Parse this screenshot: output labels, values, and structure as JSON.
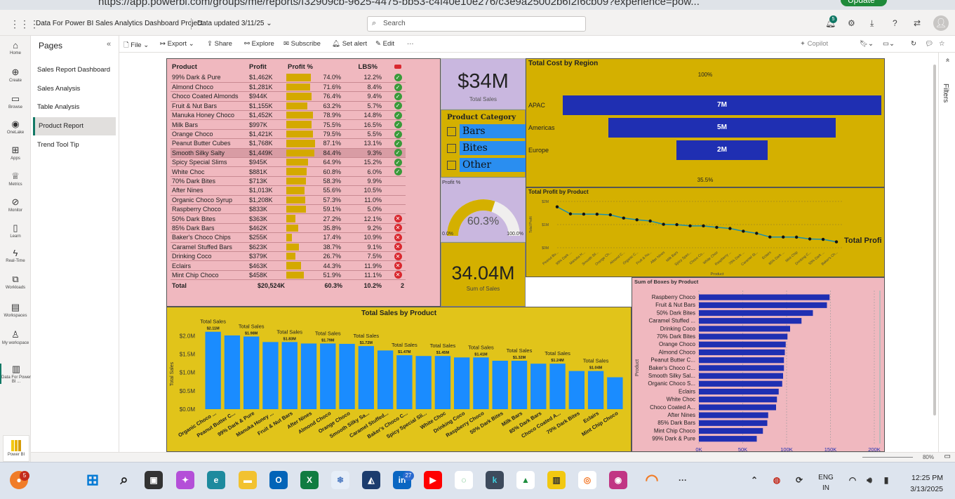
{
  "browser": {
    "url": "https://app.powerbi.com/groups/me/reports/f32909cb-9625-4475-bb53-c4f40e10e276/c3e9a25002b6f2f6cb09?experience=pow...",
    "update_label": "Update"
  },
  "app": {
    "title": "Data For Power BI Sales Analytics Dashboard Project",
    "updated": "Data updated 3/11/25",
    "search_placeholder": "Search",
    "notif_count": "5"
  },
  "nav": [
    {
      "label": "Home",
      "icon": "home-icon",
      "glyph": "⌂"
    },
    {
      "label": "Create",
      "icon": "plus-icon",
      "glyph": "⊕"
    },
    {
      "label": "Browse",
      "icon": "folder-icon",
      "glyph": "▭"
    },
    {
      "label": "OneLake",
      "icon": "onelake-icon",
      "glyph": "◉"
    },
    {
      "label": "Apps",
      "icon": "apps-icon",
      "glyph": "⊞"
    },
    {
      "label": "Metrics",
      "icon": "trophy-icon",
      "glyph": "♕"
    },
    {
      "label": "Monitor",
      "icon": "monitor-icon",
      "glyph": "⊘"
    },
    {
      "label": "Learn",
      "icon": "book-icon",
      "glyph": "▯"
    },
    {
      "label": "Real-Time",
      "icon": "lightning-icon",
      "glyph": "ϟ"
    },
    {
      "label": "Workloads",
      "icon": "workloads-icon",
      "glyph": "⧉"
    },
    {
      "label": "Workspaces",
      "icon": "workspaces-icon",
      "glyph": "▤"
    },
    {
      "label": "My workspace",
      "icon": "person-icon",
      "glyph": "♙"
    },
    {
      "label": "Data For Power BI ...",
      "icon": "report-icon",
      "glyph": "▥"
    }
  ],
  "powerbi_label": "Power BI",
  "pages": {
    "header": "Pages",
    "items": [
      "Sales Report Dashboard",
      "Sales Analysis",
      "Table Analysis",
      "Product Report",
      "Trend Tool Tip"
    ],
    "selected": 3
  },
  "toolbar": {
    "file": "File",
    "export": "Export",
    "share": "Share",
    "explore": "Explore",
    "subscribe": "Subscribe",
    "set_alert": "Set alert",
    "edit": "Edit",
    "more": "···",
    "copilot": "Copilot"
  },
  "filters_label": "Filters",
  "zoom": "80%",
  "table": {
    "headers": [
      "Product",
      "Profit",
      "Profit %",
      "LBS%"
    ],
    "rows": [
      [
        "99% Dark & Pure",
        "$1,462K",
        "74.0%",
        "12.2%",
        "ok"
      ],
      [
        "Almond Choco",
        "$1,281K",
        "71.6%",
        "8.4%",
        "ok"
      ],
      [
        "Choco Coated Almonds",
        "$944K",
        "76.4%",
        "9.4%",
        "ok"
      ],
      [
        "Fruit & Nut Bars",
        "$1,155K",
        "63.2%",
        "5.7%",
        "ok"
      ],
      [
        "Manuka Honey Choco",
        "$1,452K",
        "78.9%",
        "14.8%",
        "ok"
      ],
      [
        "Milk Bars",
        "$997K",
        "75.5%",
        "16.5%",
        "ok"
      ],
      [
        "Orange Choco",
        "$1,421K",
        "79.5%",
        "5.5%",
        "ok"
      ],
      [
        "Peanut Butter Cubes",
        "$1,768K",
        "87.1%",
        "13.1%",
        "ok"
      ],
      [
        "Smooth Silky Salty",
        "$1,449K",
        "84.4%",
        "9.3%",
        "ok"
      ],
      [
        "Spicy Special Slims",
        "$945K",
        "64.9%",
        "15.2%",
        "ok"
      ],
      [
        "White Choc",
        "$881K",
        "60.8%",
        "6.0%",
        "ok"
      ],
      [
        "70% Dark Bites",
        "$713K",
        "58.3%",
        "9.9%",
        ""
      ],
      [
        "After Nines",
        "$1,013K",
        "55.6%",
        "10.5%",
        ""
      ],
      [
        "Organic Choco Syrup",
        "$1,208K",
        "57.3%",
        "11.0%",
        ""
      ],
      [
        "Raspberry Choco",
        "$833K",
        "59.1%",
        "5.0%",
        ""
      ],
      [
        "50% Dark Bites",
        "$363K",
        "27.2%",
        "12.1%",
        "bad"
      ],
      [
        "85% Dark Bars",
        "$462K",
        "35.8%",
        "9.2%",
        "bad"
      ],
      [
        "Baker's Choco Chips",
        "$255K",
        "17.4%",
        "10.9%",
        "bad"
      ],
      [
        "Caramel Stuffed Bars",
        "$623K",
        "38.7%",
        "9.1%",
        "bad"
      ],
      [
        "Drinking Coco",
        "$379K",
        "26.7%",
        "7.5%",
        "bad"
      ],
      [
        "Eclairs",
        "$463K",
        "44.3%",
        "11.9%",
        "bad"
      ],
      [
        "Mint Chip Choco",
        "$458K",
        "51.9%",
        "11.1%",
        "bad"
      ]
    ],
    "total": [
      "Total",
      "$20,524K",
      "60.3%",
      "10.2%",
      "2"
    ],
    "bar_fraction": [
      0.74,
      0.716,
      0.764,
      0.632,
      0.789,
      0.755,
      0.795,
      0.871,
      0.844,
      0.649,
      0.608,
      0.583,
      0.556,
      0.573,
      0.591,
      0.272,
      0.358,
      0.174,
      0.387,
      0.267,
      0.443,
      0.519
    ],
    "highlighted_row": 8
  },
  "card_total_sales": {
    "value": "$34M",
    "label": "Total Sales"
  },
  "slicer": {
    "title": "Product Category",
    "options": [
      "Bars",
      "Bites",
      "Other"
    ]
  },
  "gauge": {
    "title": "Profit %",
    "value": "60.3%",
    "min": "0.0%",
    "max": "100.0%",
    "fraction": 0.603
  },
  "card_sum_sales": {
    "value": "34.04M",
    "label": "Sum of Sales"
  },
  "funnel": {
    "title": "Total Cost by Region",
    "top_label": "100%",
    "bottom_label": "35.5%",
    "regions": [
      "APAC",
      "Americas",
      "Europe"
    ],
    "labels": [
      "7M",
      "5M",
      "2M"
    ],
    "values": [
      7,
      5,
      2
    ]
  },
  "line": {
    "title": "Total Profit by Product",
    "legend": "Total Profi",
    "ylabel": "Total Profit",
    "xlabel": "Product",
    "yticks": [
      "$2M",
      "$1M",
      "$0M"
    ],
    "categories": [
      "Peanut Bu...",
      "99% Dark ...",
      "Manuka H...",
      "Smooth Sil...",
      "Orange Ch...",
      "Almond C...",
      "Organic C...",
      "Fruit & Nu...",
      "After Nines",
      "Milk Bars",
      "Spicy Spec...",
      "Choco Co...",
      "White Choc",
      "Raspberry ...",
      "70% Dark ...",
      "Caramel St...",
      "Eclairs",
      "85% Dark ...",
      "Mint Chip",
      "Drinking C...",
      "50% Dark ...",
      "Baker's Ch..."
    ],
    "values": [
      1.768,
      1.462,
      1.452,
      1.449,
      1.421,
      1.281,
      1.208,
      1.155,
      1.013,
      0.997,
      0.945,
      0.944,
      0.881,
      0.833,
      0.713,
      0.623,
      0.463,
      0.462,
      0.458,
      0.379,
      0.363,
      0.255
    ]
  },
  "colbar": {
    "title": "Total Sales by Product",
    "ylabel": "Total Sales",
    "yticks": [
      "$2.0M",
      "$1.5M",
      "$1.0M",
      "$0.5M",
      "$0.0M"
    ],
    "series_label": "Total Sales",
    "categories": [
      "Organic Choco ...",
      "Peanut Butter C...",
      "99% Dark & Pure",
      "Manuka Honey ...",
      "Fruit & Nut Bars",
      "After Nines",
      "Almond Choco",
      "Orange Choco",
      "Smooth Silky Sa...",
      "Caramel Stuffed...",
      "Baker's Choco C...",
      "Spicy Special Sli...",
      "White Choc",
      "Drinking Coco",
      "Raspberry Choco",
      "50% Dark Bites",
      "Milk Bars",
      "85% Dark Bars",
      "Choco Coated A...",
      "70% Dark Bites",
      "Eclairs",
      "Mint Chip Choco"
    ],
    "values": [
      2.11,
      2.01,
      1.98,
      1.83,
      1.83,
      1.79,
      1.79,
      1.78,
      1.72,
      1.6,
      1.47,
      1.45,
      1.45,
      1.41,
      1.41,
      1.32,
      1.32,
      1.24,
      1.24,
      1.04,
      1.04,
      0.87
    ],
    "data_labels": [
      "$2.11M",
      "",
      "$1.98M",
      "",
      "$1.83M",
      "",
      "$1.79M",
      "",
      "$1.72M",
      "",
      "$1.47M",
      "",
      "$1.45M",
      "",
      "$1.41M",
      "",
      "$1.32M",
      "",
      "$1.24M",
      "",
      "$1.04M",
      ""
    ]
  },
  "hbar": {
    "title": "Sum of Boxes by Product",
    "ylabel": "Product",
    "xticks": [
      "0K",
      "50K",
      "100K",
      "150K",
      "200K"
    ],
    "categories": [
      "Raspberry Choco",
      "Fruit & Nut Bars",
      "50% Dark Bites",
      "Caramel Stuffed ...",
      "Drinking Coco",
      "70% Dark Bites",
      "Orange Choco",
      "Almond Choco",
      "Peanut Butter C...",
      "Baker's Choco C...",
      "Smooth Silky Sal...",
      "Organic Choco S...",
      "Eclairs",
      "White Choc",
      "Choco Coated A...",
      "After Nines",
      "85% Dark Bars",
      "Mint Chip Choco",
      "99% Dark & Pure"
    ],
    "values": [
      149,
      146,
      130,
      117,
      104,
      101,
      99,
      98,
      97,
      97,
      96,
      95,
      91,
      89,
      88,
      79,
      78,
      73,
      66
    ]
  },
  "chart_data": [
    {
      "type": "table",
      "title": "",
      "columns": [
        "Product",
        "Profit",
        "Profit %",
        "LBS%"
      ]
    },
    {
      "type": "bar",
      "title": "Total Cost by Region",
      "categories": [
        "APAC",
        "Americas",
        "Europe"
      ],
      "values": [
        7,
        5,
        2
      ]
    },
    {
      "type": "line",
      "title": "Total Profit by Product",
      "xlabel": "Product",
      "ylabel": "Total Profit",
      "ylim": [
        0,
        2
      ]
    },
    {
      "type": "bar",
      "title": "Total Sales by Product",
      "xlabel": "",
      "ylabel": "Total Sales",
      "ylim": [
        0,
        2.2
      ]
    },
    {
      "type": "bar",
      "title": "Sum of Boxes by Product",
      "xlabel": "",
      "ylabel": "Product",
      "xlim": [
        0,
        200
      ]
    }
  ],
  "taskbar": {
    "badge_left": "5",
    "linkedin_badge": "27",
    "lang1": "ENG",
    "lang2": "IN",
    "time": "12:25 PM",
    "date": "3/13/2025"
  }
}
